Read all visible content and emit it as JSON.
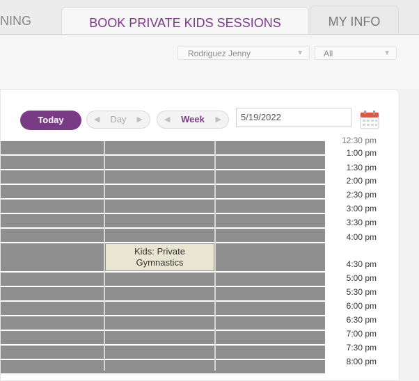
{
  "tabs": {
    "partial": "NING",
    "active": "BOOK PRIVATE KIDS SESSIONS",
    "myinfo": "MY INFO"
  },
  "filters": {
    "instructor": "Rodriguez Jenny",
    "type": "All"
  },
  "toolbar": {
    "today": "Today",
    "day": "Day",
    "week": "Week",
    "date": "5/19/2022"
  },
  "event": {
    "line1": "Kids: Private",
    "line2": "Gymnastics"
  },
  "times": [
    "12:30 pm",
    "1:00 pm",
    "1:30 pm",
    "2:00 pm",
    "2:30 pm",
    "3:00 pm",
    "3:30 pm",
    "4:00 pm",
    "4:30 pm",
    "5:00 pm",
    "5:30 pm",
    "6:00 pm",
    "6:30 pm",
    "7:00 pm",
    "7:30 pm",
    "8:00 pm"
  ],
  "colors": {
    "accent": "#7a3b86",
    "slot": "#8e8e8e",
    "event": "#e8e6d2"
  }
}
